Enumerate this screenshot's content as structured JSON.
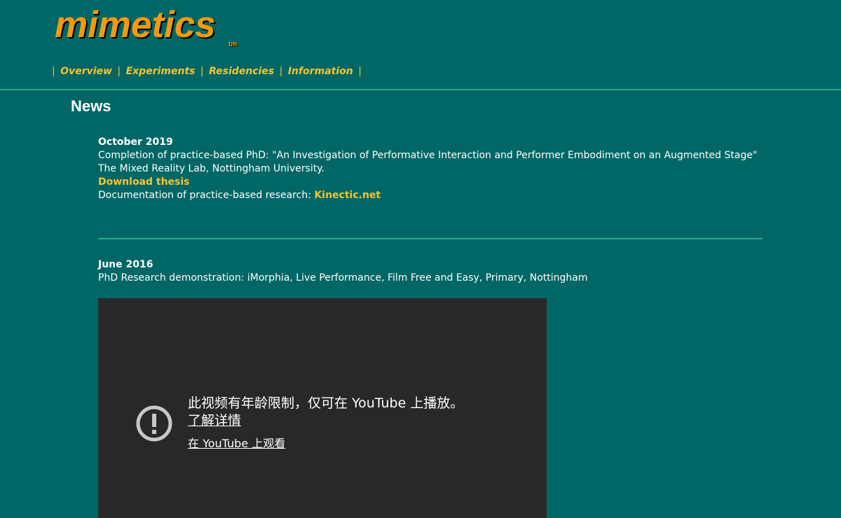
{
  "header": {
    "logo": "mimetics",
    "logo_tm": "tm",
    "nav": {
      "separator": "|",
      "items": [
        {
          "label": "Overview"
        },
        {
          "label": "Experiments"
        },
        {
          "label": "Residencies"
        },
        {
          "label": "Information"
        }
      ]
    }
  },
  "colors": {
    "background": "#006766",
    "logo": "#f39a12",
    "link": "#f4c430",
    "rule": "#2aa890",
    "video_background": "#282828"
  },
  "news": {
    "title": "News",
    "entries": [
      {
        "date": "October 2019",
        "text": "Completion of practice-based PhD: \"An Investigation of Performative Interaction and Performer Embodiment on an Augmented Stage\"",
        "institution": "The Mixed Reality Lab, Nottingham University.",
        "download_link": "Download thesis",
        "documentation_prefix": "Documentation of practice-based research: ",
        "documentation_link": "Kinectic.net"
      },
      {
        "date": "June 2016",
        "text": "PhD Research demonstration: iMorphia, Live Performance, Film Free and Easy, Primary, Nottingham"
      }
    ]
  },
  "video": {
    "icon": "alert-circle-icon",
    "message": "此视频有年龄限制，仅可在 YouTube 上播放。",
    "learn_more": "了解详情",
    "watch_on_youtube": "在 YouTube 上观看"
  }
}
